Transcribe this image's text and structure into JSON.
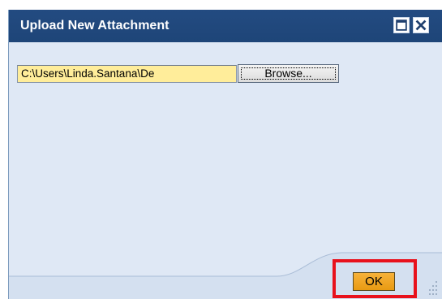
{
  "dialog": {
    "title": "Upload New Attachment",
    "buttons": {
      "maximize_icon": "maximize-icon",
      "close_icon": "close-icon"
    }
  },
  "form": {
    "file_path_value": "C:\\Users\\Linda.Santana\\De",
    "browse_label": "Browse..."
  },
  "footer": {
    "ok_label": "OK"
  },
  "colors": {
    "titlebar": "#234b81",
    "body": "#dfe8f5",
    "field_highlight": "#ffed9a",
    "ok_button": "#f0a629",
    "annotation": "#e8111c"
  }
}
